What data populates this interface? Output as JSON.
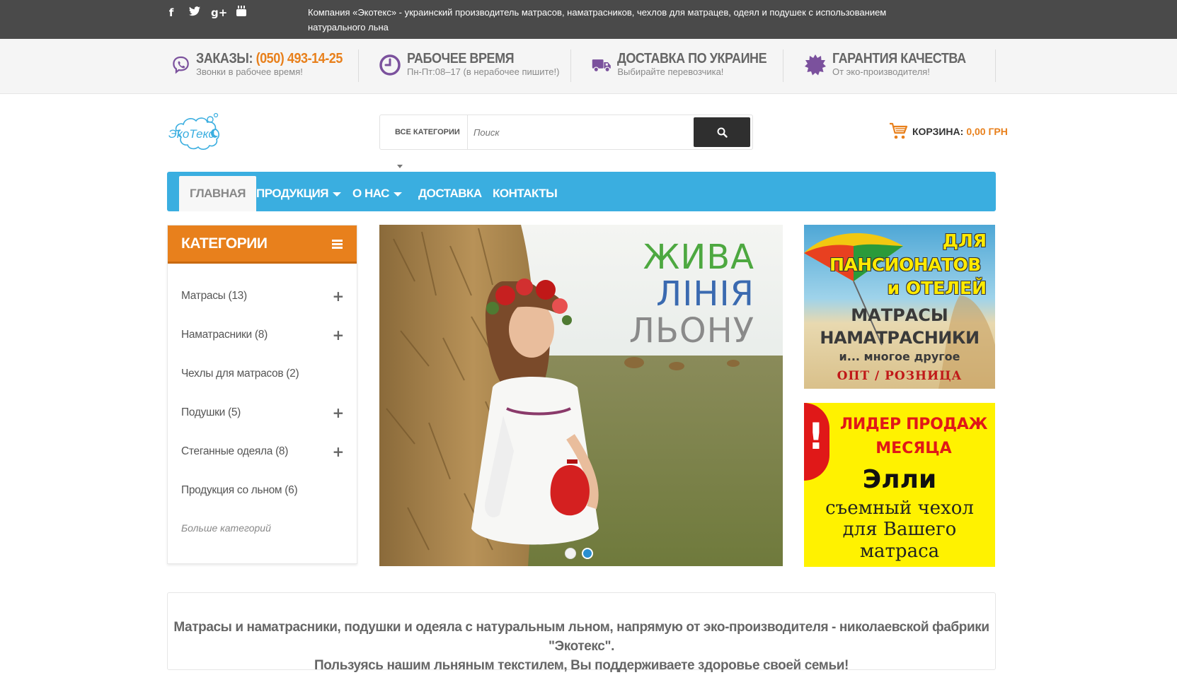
{
  "topbar": {
    "social": [
      "f",
      "t",
      "g+",
      "yt"
    ],
    "text": "Компания «Экотекс» - украинский производитель матрасов, наматрасников, чехлов для матрацев, одеял и подушек с использованием натурального льна"
  },
  "info": {
    "orders": {
      "title": "ЗАКАЗЫ:",
      "phone": "(050) 493-14-25",
      "sub": "Звонки в рабочее время!",
      "icon": "viber-icon"
    },
    "hours": {
      "title": "РАБОЧЕЕ ВРЕМЯ",
      "sub": "Пн-Пт:08–17 (в нерабочее пишите!)",
      "icon": "clock-icon"
    },
    "delivery": {
      "title": "ДОСТАВКА ПО УКРАИНЕ",
      "sub": "Выбирайте перевозчика!",
      "icon": "truck-icon"
    },
    "quality": {
      "title": "ГАРАНТИЯ КАЧЕСТВА",
      "sub": "От эко-производителя!",
      "icon": "badge-icon"
    }
  },
  "logo": {
    "text": "ЭкоТекс"
  },
  "search": {
    "category": "ВСЕ КАТЕГОРИИ",
    "placeholder": "Поиск"
  },
  "cart": {
    "label": "КОРЗИНА:",
    "value": "0,00 ГРН"
  },
  "nav": {
    "items": [
      {
        "label": "ГЛАВНАЯ"
      },
      {
        "label": "ПРОДУКЦИЯ"
      },
      {
        "label": "О НАС"
      },
      {
        "label": "ДОСТАВКА"
      },
      {
        "label": "КОНТАКТЫ"
      }
    ]
  },
  "categories": {
    "title": "КАТЕГОРИИ",
    "items": [
      {
        "label": "Матрасы (13)"
      },
      {
        "label": "Наматрасники (8)"
      },
      {
        "label": "Чехлы для матрасов (2)"
      },
      {
        "label": "Подушки (5)"
      },
      {
        "label": "Стеганные одеяла (8)"
      },
      {
        "label": "Продукция со льном (6)"
      }
    ],
    "more": "Больше категорий"
  },
  "slider": {
    "line1": "ЖИВА",
    "line2": "ЛІНІЯ",
    "line3": "ЛЬОНУ"
  },
  "banner1": {
    "line1": "ДЛЯ",
    "line2": "ПАНСИОНАТОВ",
    "line3": "и ОТЕЛЕЙ",
    "line4": "МАТРАСЫ",
    "line5": "НАМАТРАСНИКИ",
    "line6": "и... многое другое",
    "line7": "ОПТ / РОЗНИЦА"
  },
  "banner2": {
    "excl": "!",
    "line1": "ЛИДЕР ПРОДАЖ",
    "line2": "МЕСЯЦА",
    "line3": "Элли",
    "line4": "съемный чехол",
    "line5": "для Вашего",
    "line6": "матраса"
  },
  "about": {
    "line1": "Матрасы и наматрасники, подушки и одеяла с натуральным льном, напрямую от эко-производителя - николаевской фабрики \"Экотекс\".",
    "line2": "Пользуясь нашим льняным текстилем, Вы поддерживаете здоровье своей семьи!"
  }
}
